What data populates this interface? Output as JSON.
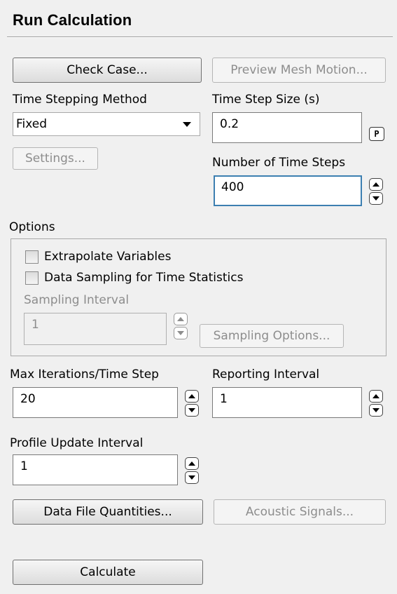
{
  "panel": {
    "title": "Run Calculation"
  },
  "buttons": {
    "check_case": "Check Case...",
    "preview_mesh_motion": "Preview Mesh Motion...",
    "settings": "Settings...",
    "sampling_options": "Sampling Options...",
    "data_file_quantities": "Data File Quantities...",
    "acoustic_signals": "Acoustic Signals...",
    "calculate": "Calculate"
  },
  "time_stepping": {
    "method_label": "Time Stepping Method",
    "method_value": "Fixed",
    "step_size_label": "Time Step Size (s)",
    "step_size_value": "0.2",
    "parameter_icon": "P",
    "num_steps_label": "Number of Time Steps",
    "num_steps_value": "400"
  },
  "options": {
    "label": "Options",
    "extrapolate_variables": {
      "label": "Extrapolate Variables",
      "checked": false
    },
    "data_sampling": {
      "label": "Data Sampling for Time Statistics",
      "checked": false
    },
    "sampling_interval_label": "Sampling Interval",
    "sampling_interval_value": "1"
  },
  "iteration": {
    "max_iter_label": "Max Iterations/Time Step",
    "max_iter_value": "20",
    "reporting_interval_label": "Reporting Interval",
    "reporting_interval_value": "1",
    "profile_update_label": "Profile Update Interval",
    "profile_update_value": "1"
  },
  "icons": {
    "spinner_up": "triangle-up",
    "spinner_down": "triangle-down",
    "dropdown": "chevron-down",
    "parameter": "parameter-p"
  }
}
